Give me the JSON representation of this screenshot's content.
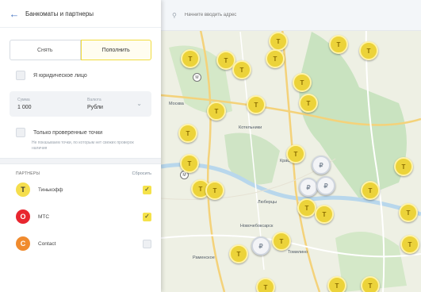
{
  "header": {
    "title": "Банкоматы и партнеры"
  },
  "toggle": {
    "left": "Снять",
    "right": "Пополнить"
  },
  "legal": {
    "label": "Я юридическое лицо"
  },
  "amount": {
    "amount_label": "Сумма",
    "amount_value": "1 000",
    "currency_label": "Валюта",
    "currency_value": "Рубли"
  },
  "verified": {
    "label": "Только проверенные точки",
    "note": "Не показываем точки, по которым нет свежих проверок наличия"
  },
  "partners": {
    "heading": "ПАРТНЕРЫ",
    "reset": "Сбросить",
    "items": [
      {
        "name": "Тинькофф",
        "checked": true,
        "logo_color": "#f5de4d",
        "logo_text": "T"
      },
      {
        "name": "МТС",
        "checked": true,
        "logo_color": "#e8262f",
        "logo_text": "O"
      },
      {
        "name": "Contact",
        "checked": false,
        "logo_color": "#f08b2e",
        "logo_text": "C"
      }
    ]
  },
  "map": {
    "search_placeholder": "Начните вводить адрес",
    "labels": [
      "Котельники",
      "Красково",
      "Люберцы",
      "Томилино",
      "Новочебоксарск",
      "Москва",
      "Раменское"
    ],
    "pin_glyph": "Т",
    "gray_glyph": "₽"
  },
  "colors": {
    "accent_yellow": "#f5e24a",
    "link_blue": "#4b79c4",
    "water": "#b8d7ec",
    "park": "#c9e3c0"
  }
}
